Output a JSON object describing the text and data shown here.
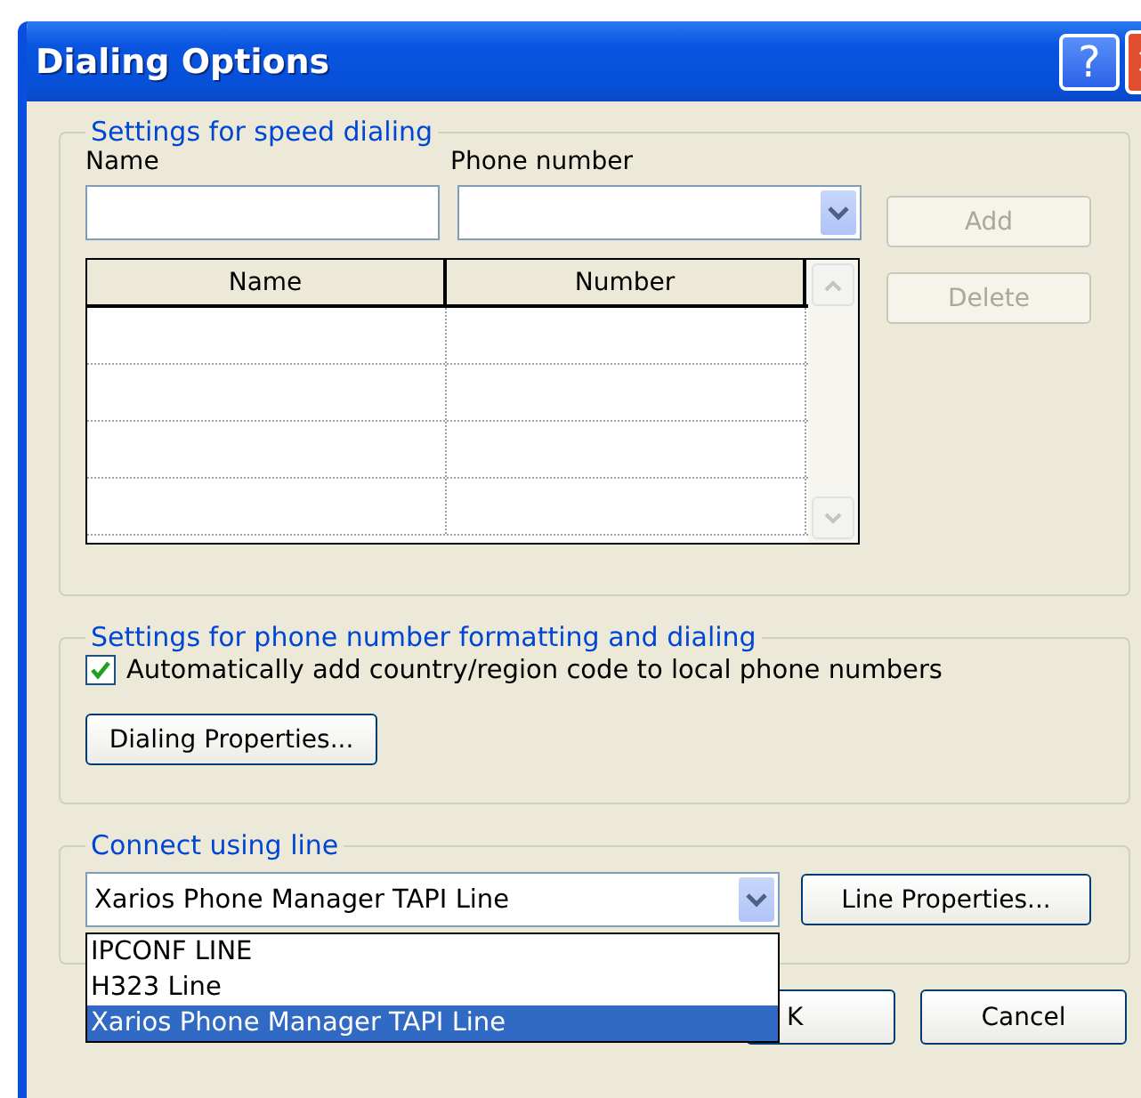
{
  "window": {
    "title": "Dialing Options",
    "help_glyph": "?"
  },
  "speed_dialing": {
    "legend": "Settings for speed dialing",
    "name_label": "Name",
    "phone_label": "Phone number",
    "columns": [
      "Name",
      "Number"
    ],
    "buttons": [
      {
        "label": "Add",
        "disabled": true
      },
      {
        "label": "Delete",
        "disabled": true
      }
    ]
  },
  "formatting": {
    "legend": "Settings for phone number formatting and dialing",
    "checkbox": {
      "label": "Automatically add country/region code to local phone numbers",
      "checked": true
    },
    "button": "Dialing Properties..."
  },
  "line": {
    "legend": "Connect using line",
    "value": "Xarios Phone Manager TAPI Line",
    "button": "Line Properties...",
    "options": [
      {
        "label": "IPCONF LINE",
        "selected": false
      },
      {
        "label": "H323 Line",
        "selected": false
      },
      {
        "label": "Xarios Phone Manager TAPI Line",
        "selected": true
      }
    ]
  },
  "footer_buttons": [
    "K",
    "Cancel"
  ]
}
